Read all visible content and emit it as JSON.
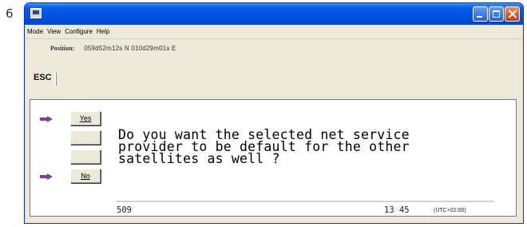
{
  "page_number": "6",
  "window": {
    "menu": [
      "Mode",
      "View",
      "Configure",
      "Help"
    ]
  },
  "position": {
    "label": "Position:",
    "value": "059d52m12s N  010d29m01s E"
  },
  "toolbar": {
    "esc_label": "ESC"
  },
  "dialog": {
    "yes_label": "Yes",
    "no_label": "No",
    "message": "Do you want the selected net service\nprovider to be default for the other\nsatellites as well ?"
  },
  "status": {
    "code": "509",
    "time": "13 45",
    "timezone": "(UTC+02:00)"
  },
  "colors": {
    "titlebar": "#0054e3",
    "arrow": "#7a3fa0",
    "window_bg": "#ece9d8"
  }
}
